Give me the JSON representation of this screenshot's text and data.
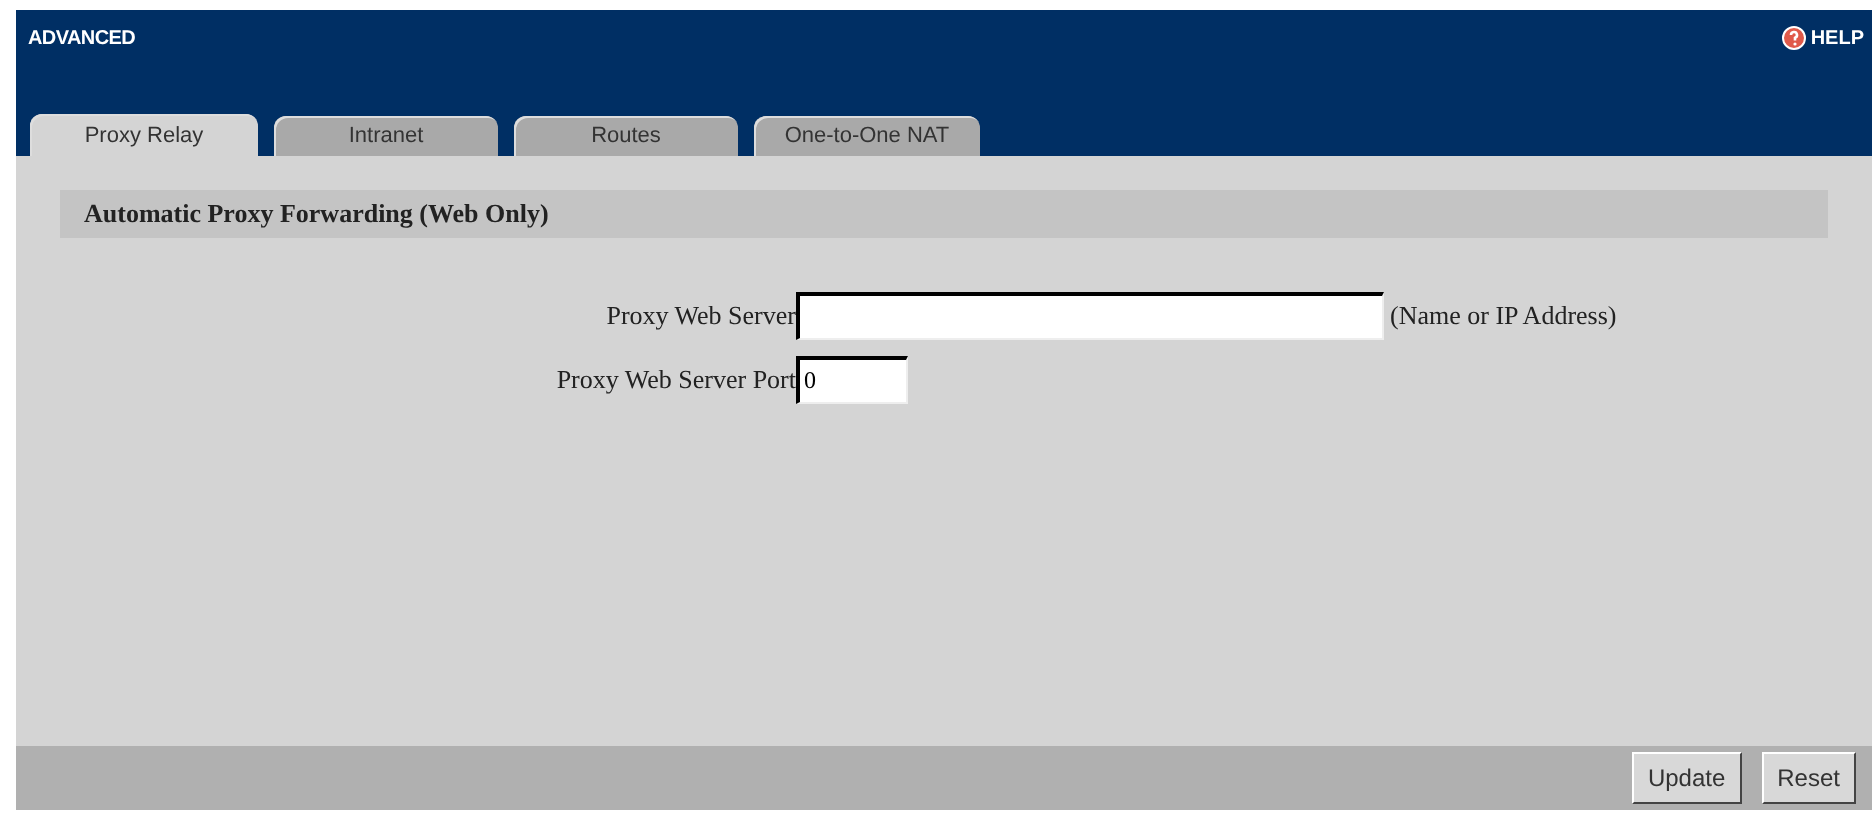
{
  "window": {
    "title": "ADVANCED"
  },
  "help": {
    "label": "HELP"
  },
  "tabs": [
    {
      "label": "Proxy Relay",
      "selected": true
    },
    {
      "label": "Intranet",
      "selected": false
    },
    {
      "label": "Routes",
      "selected": false
    },
    {
      "label": "One-to-One NAT",
      "selected": false
    }
  ],
  "section": {
    "title": "Automatic Proxy Forwarding (Web Only)"
  },
  "fields": [
    {
      "label": "Proxy Web Server",
      "hint": "(Name or IP Address)"
    },
    {
      "label": "Proxy Web Server Port",
      "value": "0"
    }
  ],
  "buttons": [
    "Update",
    "Reset"
  ]
}
